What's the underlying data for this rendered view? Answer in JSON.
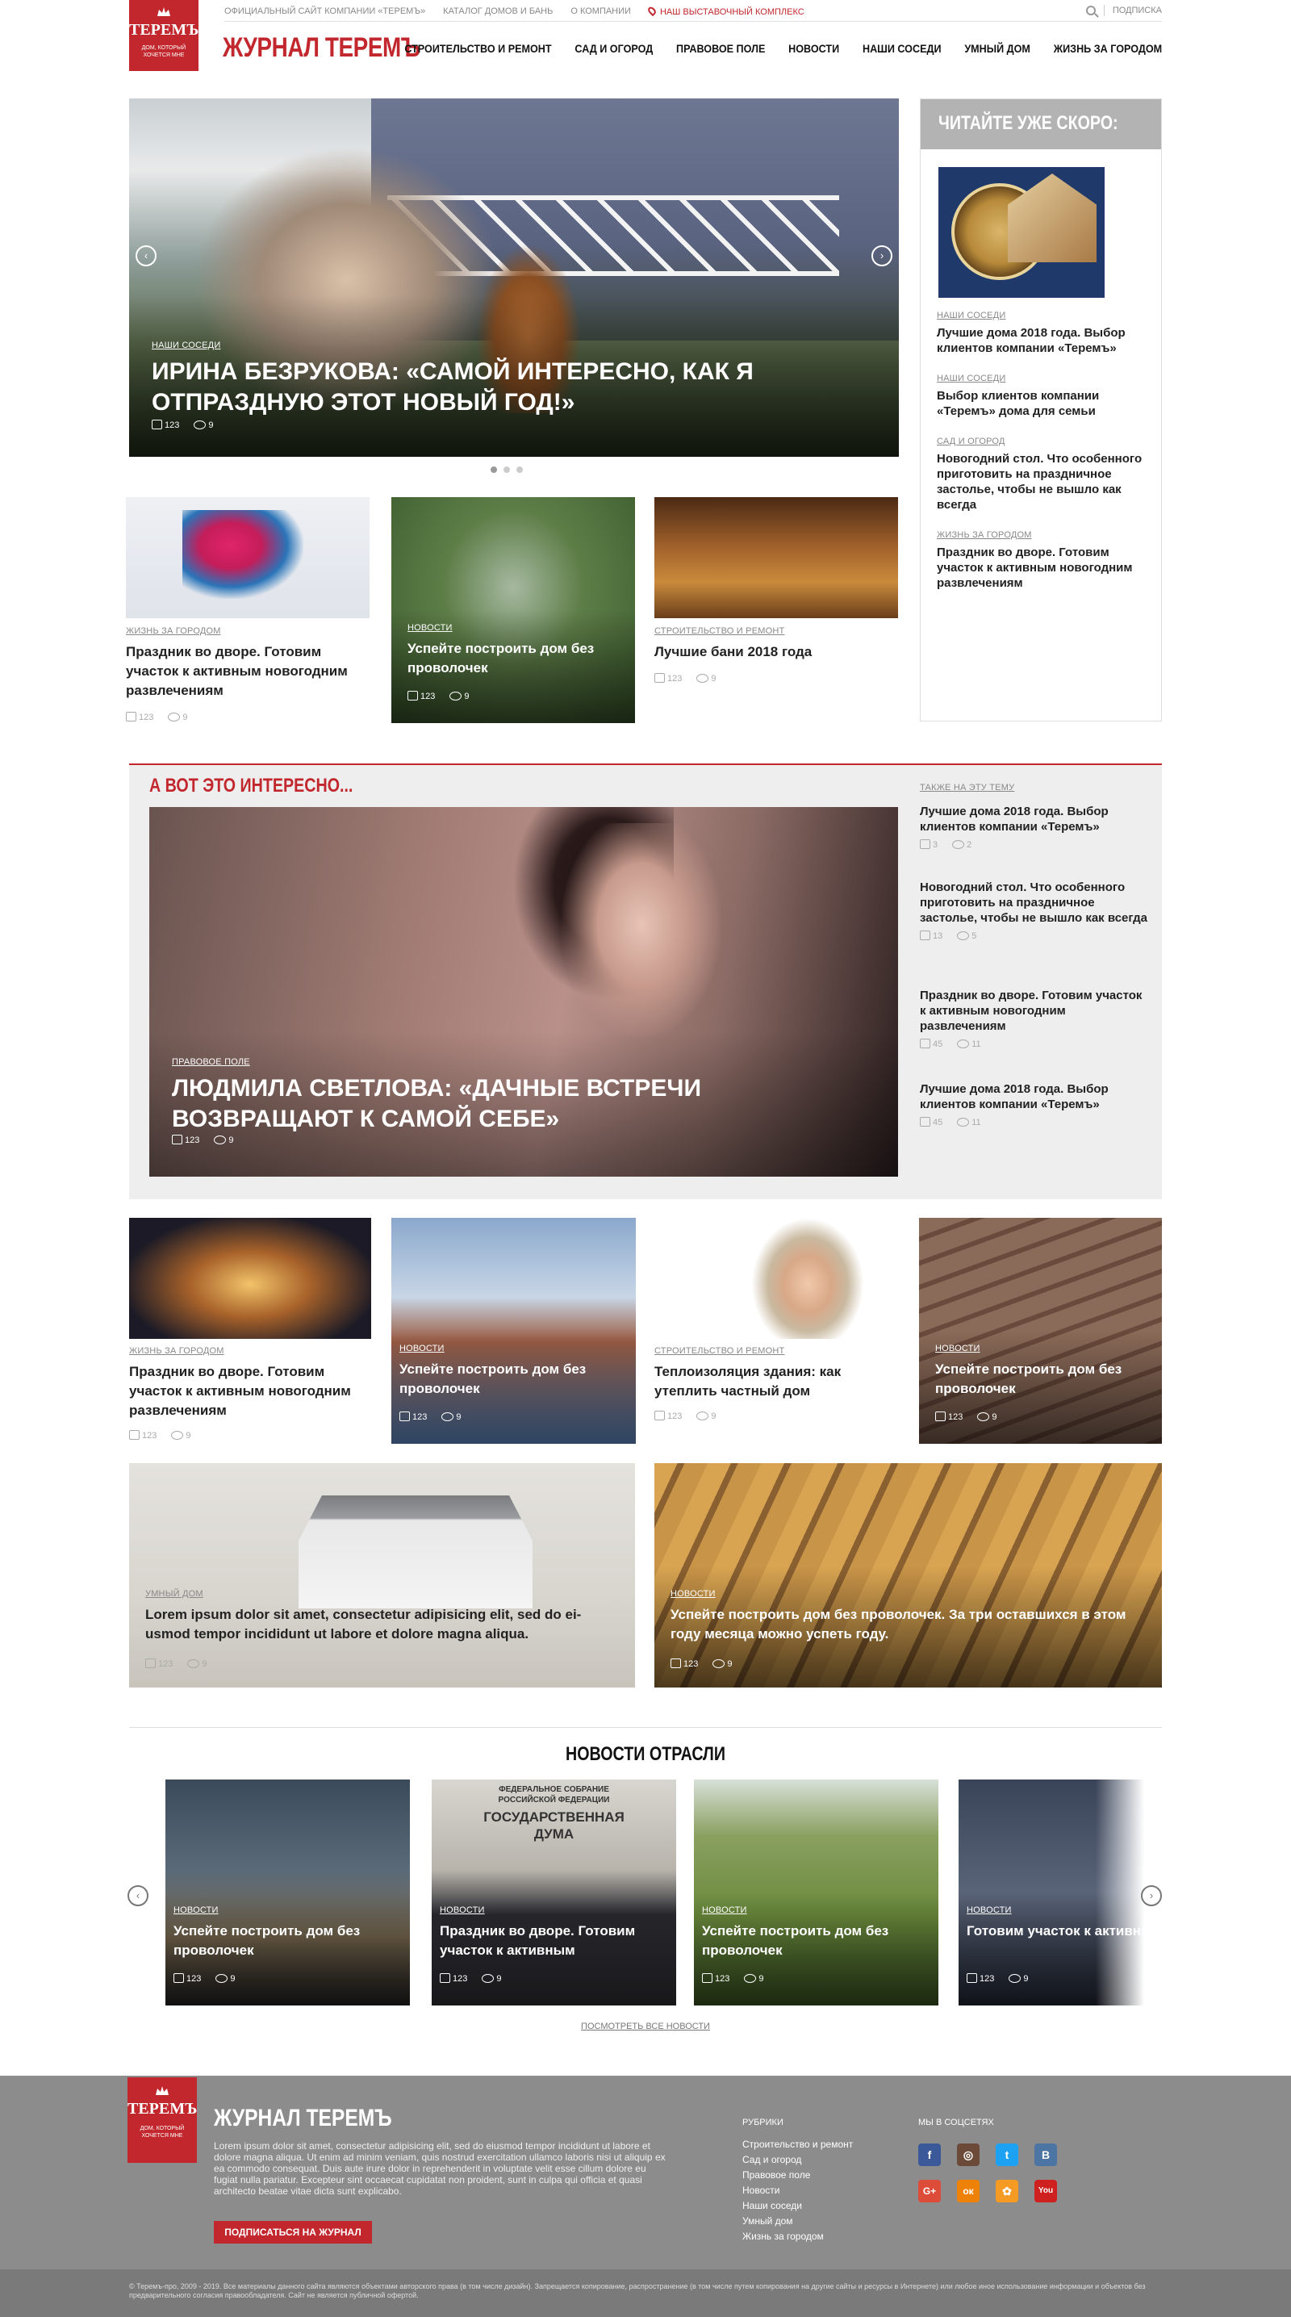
{
  "header": {
    "logo_brand": "ТЕРЕМЪ",
    "logo_tagline": "ДОМ, КОТОРЫЙ ХОЧЕТСЯ МНЕ",
    "top_links": [
      "ОФИЦИАЛЬНЫЙ САЙТ КОМПАНИИ «ТЕРЕМЪ»",
      "КАТАЛОГ ДОМОВ И БАНЬ",
      "О КОМПАНИИ"
    ],
    "exhibition_link": "НАШ ВЫСТАВОЧНЫЙ КОМПЛЕКС",
    "subscribe": "ПОДПИСКА",
    "title": "ЖУРНАЛ ТЕРЕМЪ",
    "nav": [
      "СТРОИТЕЛЬСТВО И РЕМОНТ",
      "САД И ОГОРОД",
      "ПРАВОВОЕ ПОЛЕ",
      "НОВОСТИ",
      "НАШИ СОСЕДИ",
      "УМНЫЙ ДОМ",
      "ЖИЗНЬ ЗА ГОРОДОМ"
    ]
  },
  "hero": {
    "category": "НАШИ СОСЕДИ",
    "title": "ИРИНА БЕЗРУКОВА: «САМОЙ ИНТЕРЕСНО, КАК Я ОТПРАЗДНУЮ ЭТОТ НОВЫЙ ГОД!»",
    "likes": "123",
    "comments": "9",
    "prev": "‹",
    "next": "›"
  },
  "sidebar": {
    "title": "ЧИТАЙТЕ УЖЕ СКОРО:",
    "items": [
      {
        "category": "НАШИ СОСЕДИ",
        "title": "Лучшие дома 2018 года. Выбор клиентов компании «Теремъ»"
      },
      {
        "category": "НАШИ СОСЕДИ",
        "title": "Выбор клиентов компании «Теремъ» дома для семьи"
      },
      {
        "category": "САД И ОГОРОД",
        "title": "Новогодний стол. Что особенного приготовить на праздничное застолье, чтобы не вышло как всегда"
      },
      {
        "category": "ЖИЗНЬ ЗА ГОРОДОМ",
        "title": "Праздник во дворе. Готовим участок к активным новогодним развлечениям"
      }
    ]
  },
  "row1": [
    {
      "category": "ЖИЗНЬ ЗА ГОРОДОМ",
      "title": "Праздник во дворе. Готовим участок к активным новогодним развлечениям",
      "likes": "123",
      "comments": "9"
    },
    {
      "category": "НОВОСТИ",
      "title": "Успейте построить дом без проволочек",
      "likes": "123",
      "comments": "9"
    },
    {
      "category": "СТРОИТЕЛЬСТВО И РЕМОНТ",
      "title": "Лучшие бани 2018 года",
      "likes": "123",
      "comments": "9"
    }
  ],
  "interesting": {
    "title": "А ВОТ ЭТО ИНТЕРЕСНО...",
    "category": "ПРАВОВОЕ ПОЛЕ",
    "main_title": "ЛЮДМИЛА СВЕТЛОВА: «ДАЧНЫЕ ВСТРЕЧИ ВОЗВРАЩАЮТ К САМОЙ СЕБЕ»",
    "likes": "123",
    "comments": "9",
    "also_label": "ТАКЖЕ НА ЭТУ ТЕМУ",
    "also": [
      {
        "title": "Лучшие дома 2018 года. Выбор клиентов компании «Теремъ»",
        "likes": "3",
        "comments": "2"
      },
      {
        "title": "Новогодний стол. Что особенного приготовить на праздничное застолье, чтобы не вышло как всегда",
        "likes": "13",
        "comments": "5"
      },
      {
        "title": "Праздник во дворе. Готовим участок к активным новогодним развлечениям",
        "likes": "45",
        "comments": "11"
      },
      {
        "title": "Лучшие дома 2018 года. Выбор клиентов компании «Теремъ»",
        "likes": "45",
        "comments": "11"
      }
    ]
  },
  "row2": [
    {
      "category": "ЖИЗНЬ ЗА ГОРОДОМ",
      "title": "Праздник во дворе. Готовим участок к активным новогодним развлечениям",
      "likes": "123",
      "comments": "9"
    },
    {
      "category": "НОВОСТИ",
      "title": "Успейте построить дом без проволочек",
      "likes": "123",
      "comments": "9"
    },
    {
      "category": "СТРОИТЕЛЬСТВО И РЕМОНТ",
      "title": "Теплоизоляция здания: как утеплить частный дом",
      "likes": "123",
      "comments": "9"
    },
    {
      "category": "НОВОСТИ",
      "title": "Успейте построить дом без проволочек",
      "likes": "123",
      "comments": "9"
    }
  ],
  "row3": [
    {
      "category": "УМНЫЙ ДОМ",
      "title": "Lorem ipsum dolor sit amet, consectetur adipisicing elit, sed do ei-usmod tempor incididunt ut labore et dolore magna aliqua.",
      "likes": "123",
      "comments": "9"
    },
    {
      "category": "НОВОСТИ",
      "title": "Успейте построить дом без проволочек. За три оставшихся в этом году месяца можно успеть году.",
      "likes": "123",
      "comments": "9"
    }
  ],
  "industry": {
    "title": "НОВОСТИ ОТРАСЛИ",
    "prev": "‹",
    "next": "›",
    "items": [
      {
        "category": "НОВОСТИ",
        "title": "Успейте построить дом без проволочек",
        "likes": "123",
        "comments": "9"
      },
      {
        "category": "НОВОСТИ",
        "title": "Праздник во дворе. Готовим участок к активным",
        "likes": "123",
        "comments": "9",
        "photo_text_1": "ФЕДЕРАЛЬНОЕ СОБРАНИЕ",
        "photo_text_2": "РОССИЙСКОЙ ФЕДЕРАЦИИ",
        "photo_text_3": "ГОСУДАРСТВЕННАЯ",
        "photo_text_4": "ДУМА"
      },
      {
        "category": "НОВОСТИ",
        "title": "Успейте построить дом без проволочек",
        "likes": "123",
        "comments": "9"
      },
      {
        "category": "НОВОСТИ",
        "title": "Готовим участок к активным новогодним развлечениям",
        "likes": "123",
        "comments": "9"
      }
    ],
    "all_link": "ПОСМОТРЕТЬ ВСЕ НОВОСТИ"
  },
  "footer": {
    "title": "ЖУРНАЛ ТЕРЕМЪ",
    "text": "Lorem ipsum dolor sit amet, consectetur adipisicing elit, sed do eiusmod tempor incididunt ut labore et dolore magna aliqua. Ut enim ad minim veniam, quis nostrud exercitation ullamco laboris nisi ut aliquip ex ea commodo consequat. Duis aute irure dolor in reprehenderit in voluptate velit esse cillum dolore eu fugiat nulla pariatur. Excepteur sint occaecat cupidatat non proident, sunt in culpa qui officia et quasi architecto beatae vitae dicta sunt explicabo.",
    "subscribe_button": "ПОДПИСАТЬСЯ НА ЖУРНАЛ",
    "rubrics_title": "РУБРИКИ",
    "rubrics": [
      "Строительство и ремонт",
      "Сад и огород",
      "Правовое поле",
      "Новости",
      "Наши соседи",
      "Умный дом",
      "Жизнь за городом"
    ],
    "social_title": "МЫ В СОЦСЕТЯХ",
    "social": [
      {
        "name": "facebook-icon",
        "glyph": "f",
        "color": "#3b5998"
      },
      {
        "name": "instagram-icon",
        "glyph": "◎",
        "color": "#6b4a3a"
      },
      {
        "name": "twitter-icon",
        "glyph": "t",
        "color": "#1da1f2"
      },
      {
        "name": "vk-icon",
        "glyph": "В",
        "color": "#4c75a3"
      },
      {
        "name": "google-plus-icon",
        "glyph": "G+",
        "color": "#dd4b39"
      },
      {
        "name": "odnoklassniki-icon",
        "glyph": "ок",
        "color": "#ee8208"
      },
      {
        "name": "mymail-icon",
        "glyph": "✿",
        "color": "#f59a23"
      },
      {
        "name": "youtube-icon",
        "glyph": "You",
        "color": "#cd201f"
      }
    ],
    "copyright": "© Теремъ-про, 2009 - 2019. Все материалы данного сайта являются объектами авторского права (в том числе дизайн). Запрещается копирование, распространение (в том числе путем копирования на другие сайты и ресурсы в Интернете) или любое иное использование информации и объектов без предварительного согласия правообладателя. Сайт не является публичной офертой."
  }
}
